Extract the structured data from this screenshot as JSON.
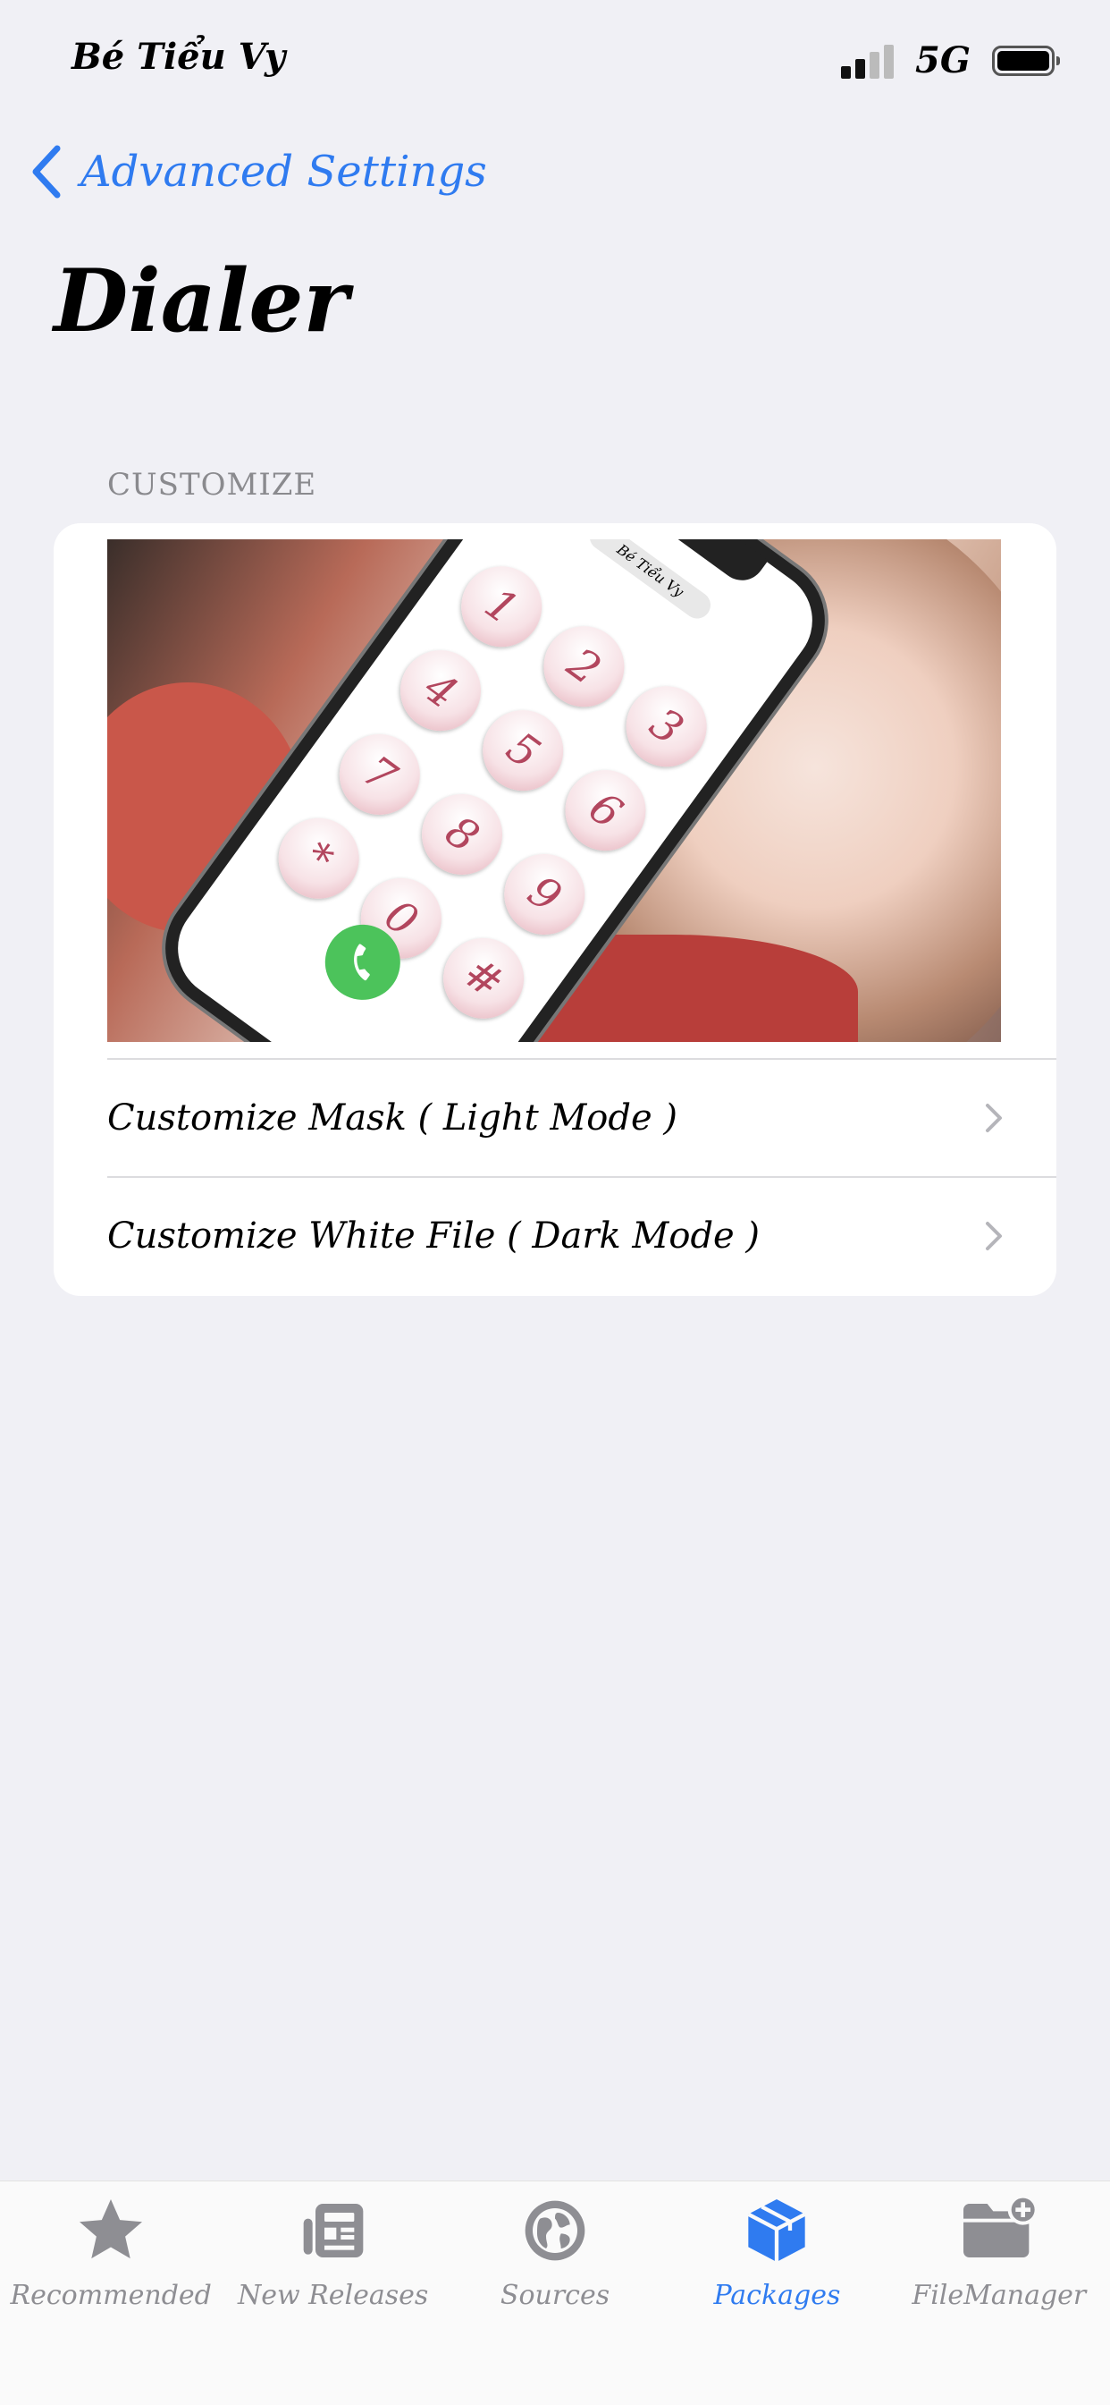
{
  "status_bar": {
    "carrier": "Bé Tiểu Vy",
    "network": "5G"
  },
  "nav": {
    "back_label": "Advanced Settings"
  },
  "page": {
    "title": "Dialer"
  },
  "section": {
    "header": "CUSTOMIZE",
    "preview": {
      "phone_pill_text": "Bé Tiểu Vy",
      "keys": [
        "1",
        "2",
        "3",
        "4",
        "5",
        "6",
        "7",
        "8",
        "9",
        "*",
        "0",
        "#"
      ]
    },
    "rows": [
      {
        "label": "Customize Mask ( Light Mode )"
      },
      {
        "label": "Customize White File ( Dark Mode )"
      }
    ]
  },
  "tab_bar": {
    "tabs": [
      {
        "label": "Recommended",
        "icon": "star-icon"
      },
      {
        "label": "New Releases",
        "icon": "newspaper-icon"
      },
      {
        "label": "Sources",
        "icon": "globe-icon"
      },
      {
        "label": "Packages",
        "icon": "box-icon"
      },
      {
        "label": "FileManager",
        "icon": "folder-plus-icon"
      }
    ],
    "active": "Packages"
  },
  "colors": {
    "accent": "#2f7bf0",
    "background": "#f0f0f5",
    "inactive": "#8e8e93"
  }
}
